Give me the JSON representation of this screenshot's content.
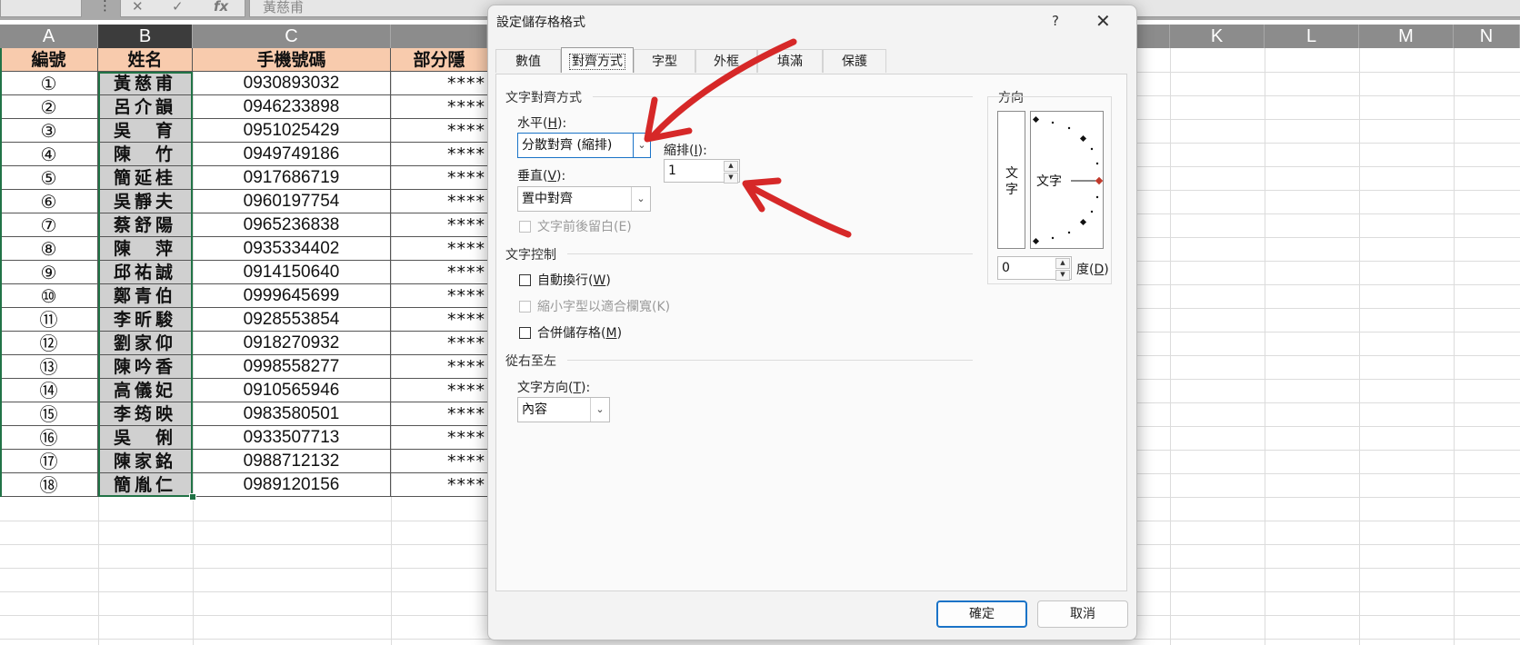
{
  "formula_bar": {
    "fx_label": "fx",
    "cancel_glyph": "✕",
    "enter_glyph": "✓",
    "more_glyph": "⋮",
    "value": "黃慈甫"
  },
  "columns": {
    "left": [
      "A",
      "B",
      "C",
      "部分隱"
    ],
    "right": [
      "K",
      "L",
      "M",
      "N"
    ]
  },
  "table": {
    "headers": [
      "編號",
      "姓名",
      "手機號碼",
      "部分隱"
    ],
    "rows": [
      {
        "idx": "①",
        "name": "黃慈甫",
        "phone": "0930893032",
        "mask": "****"
      },
      {
        "idx": "②",
        "name": "呂介韻",
        "phone": "0946233898",
        "mask": "****"
      },
      {
        "idx": "③",
        "name": "吳　育",
        "phone": "0951025429",
        "mask": "****"
      },
      {
        "idx": "④",
        "name": "陳　竹",
        "phone": "0949749186",
        "mask": "****"
      },
      {
        "idx": "⑤",
        "name": "簡延桂",
        "phone": "0917686719",
        "mask": "****"
      },
      {
        "idx": "⑥",
        "name": "吳靜夫",
        "phone": "0960197754",
        "mask": "****"
      },
      {
        "idx": "⑦",
        "name": "蔡舒陽",
        "phone": "0965236838",
        "mask": "****"
      },
      {
        "idx": "⑧",
        "name": "陳　萍",
        "phone": "0935334402",
        "mask": "****"
      },
      {
        "idx": "⑨",
        "name": "邱祐誠",
        "phone": "0914150640",
        "mask": "****"
      },
      {
        "idx": "⑩",
        "name": "鄭青伯",
        "phone": "0999645699",
        "mask": "****"
      },
      {
        "idx": "⑪",
        "name": "李昕駿",
        "phone": "0928553854",
        "mask": "****"
      },
      {
        "idx": "⑫",
        "name": "劉家仰",
        "phone": "0918270932",
        "mask": "****"
      },
      {
        "idx": "⑬",
        "name": "陳吟香",
        "phone": "0998558277",
        "mask": "****"
      },
      {
        "idx": "⑭",
        "name": "高儀妃",
        "phone": "0910565946",
        "mask": "****"
      },
      {
        "idx": "⑮",
        "name": "李筠映",
        "phone": "0983580501",
        "mask": "****"
      },
      {
        "idx": "⑯",
        "name": "吳　俐",
        "phone": "0933507713",
        "mask": "****"
      },
      {
        "idx": "⑰",
        "name": "陳家銘",
        "phone": "0988712132",
        "mask": "****"
      },
      {
        "idx": "⑱",
        "name": "簡胤仁",
        "phone": "0989120156",
        "mask": "****"
      }
    ]
  },
  "dialog": {
    "title": "設定儲存格格式",
    "help": "?",
    "close": "✕",
    "tabs": [
      "數值",
      "對齊方式",
      "字型",
      "外框",
      "填滿",
      "保護"
    ],
    "active_tab": "對齊方式",
    "text_alignment": {
      "group_title": "文字對齊方式",
      "horizontal_label": "水平",
      "horizontal_key": "H",
      "horizontal_value": "分散對齊 (縮排)",
      "vertical_label": "垂直",
      "vertical_key": "V",
      "vertical_value": "置中對齊",
      "indent_label": "縮排",
      "indent_key": "I",
      "indent_value": "1",
      "justify_distributed_label": "文字前後留白(E)"
    },
    "text_control": {
      "group_title": "文字控制",
      "wrap_label": "自動換行",
      "wrap_key": "W",
      "shrink_label": "縮小字型以適合欄寬(K)",
      "merge_label": "合併儲存格",
      "merge_key": "M"
    },
    "rtl": {
      "group_title": "從右至左",
      "direction_label": "文字方向",
      "direction_key": "T",
      "direction_value": "內容"
    },
    "orientation": {
      "group_title": "方向",
      "vertical_text": "文字",
      "angle_text": "文字",
      "degrees_value": "0",
      "degrees_label": "度",
      "degrees_key": "D"
    },
    "ok_label": "確定",
    "cancel_label": "取消"
  },
  "colors": {
    "header_fill": "#f8cbad",
    "name_fill": "#d0d0d0",
    "selection": "#217346",
    "annotation_arrow": "#d62828",
    "focus_blue": "#1a73c7"
  }
}
